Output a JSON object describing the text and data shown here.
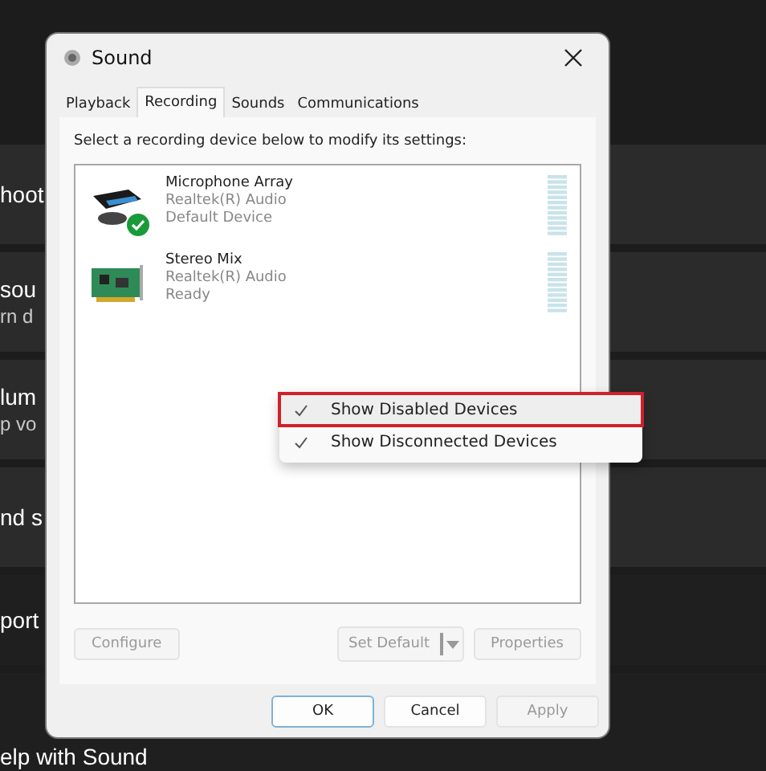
{
  "background": {
    "items": [
      {
        "lines": [
          "hoot"
        ],
        "dark": false
      },
      {
        "lines": [
          "sou",
          "rn d"
        ],
        "dark": false
      },
      {
        "lines": [
          "lum",
          "p vo"
        ],
        "dark": false
      },
      {
        "lines": [
          "nd s"
        ],
        "dark": false
      },
      {
        "lines": [
          "port"
        ],
        "dark": true
      },
      {
        "lines": [
          "elp with Sound"
        ],
        "dark": true
      }
    ]
  },
  "window": {
    "title": "Sound"
  },
  "tabs": [
    {
      "label": "Playback",
      "selected": false
    },
    {
      "label": "Recording",
      "selected": true
    },
    {
      "label": "Sounds",
      "selected": false
    },
    {
      "label": "Communications",
      "selected": false
    }
  ],
  "instruction": "Select a recording device below to modify its settings:",
  "devices": [
    {
      "name": "Microphone Array",
      "driver": "Realtek(R) Audio",
      "status": "Default Device",
      "kind": "microphone",
      "default": true
    },
    {
      "name": "Stereo Mix",
      "driver": "Realtek(R) Audio",
      "status": "Ready",
      "kind": "card",
      "default": false
    }
  ],
  "device_buttons": [
    {
      "label": "Configure",
      "disabled": true,
      "kind": "plain"
    },
    {
      "label": "Set Default",
      "disabled": true,
      "kind": "split"
    },
    {
      "label": "Properties",
      "disabled": true,
      "kind": "plain"
    }
  ],
  "dialog_buttons": [
    {
      "label": "OK",
      "disabled": false,
      "focused": true
    },
    {
      "label": "Cancel",
      "disabled": false,
      "focused": false
    },
    {
      "label": "Apply",
      "disabled": true,
      "focused": false
    }
  ],
  "context_menu": [
    {
      "label": "Show Disabled Devices",
      "checked": true,
      "selected": true
    },
    {
      "label": "Show Disconnected Devices",
      "checked": true,
      "selected": false
    }
  ]
}
